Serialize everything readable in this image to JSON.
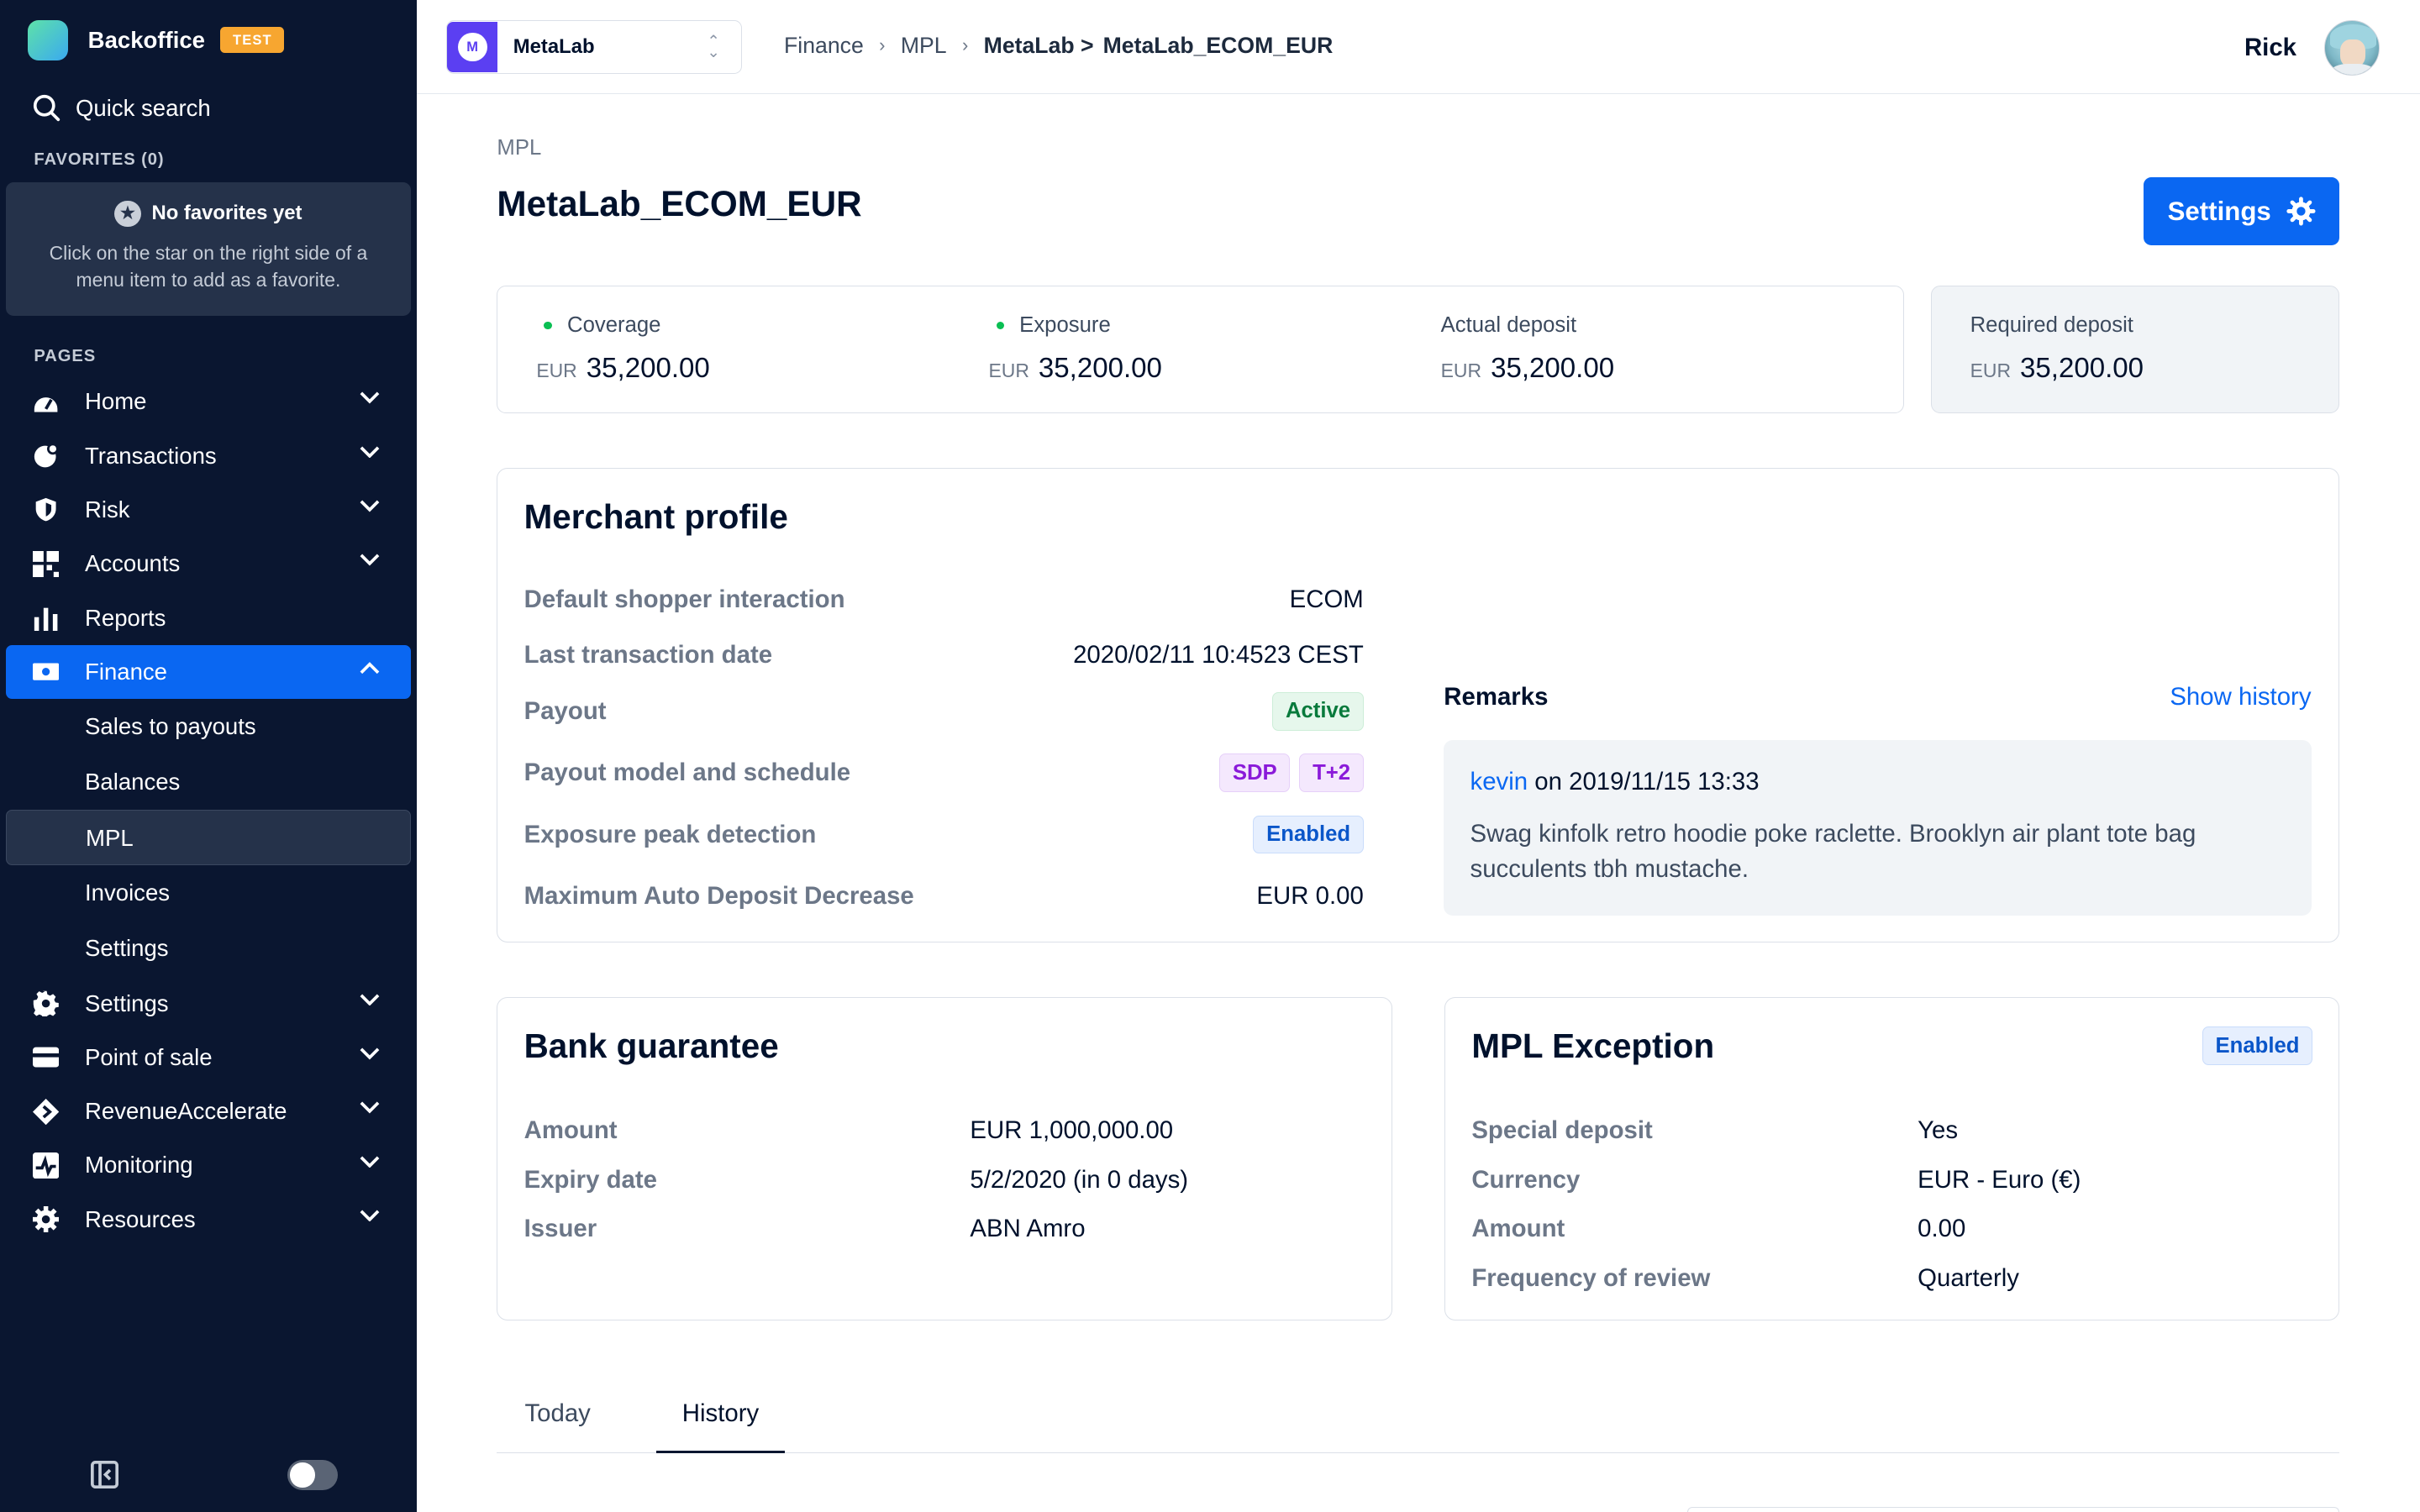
{
  "brand": {
    "name": "Backoffice",
    "env_badge": "TEST",
    "logo_colors": [
      "#5ee2a8",
      "#3aa9f0"
    ]
  },
  "search": {
    "label": "Quick search"
  },
  "favorites": {
    "title": "FAVORITES (0)",
    "empty_title": "No favorites yet",
    "empty_desc": "Click on the star on the right side of a menu item to add as a favorite."
  },
  "pages_title": "PAGES",
  "nav": {
    "home": "Home",
    "transactions": "Transactions",
    "risk": "Risk",
    "accounts": "Accounts",
    "reports": "Reports",
    "finance": "Finance",
    "finance_sub": {
      "sales_to_payouts": "Sales to payouts",
      "balances": "Balances",
      "mpl": "MPL",
      "invoices": "Invoices",
      "settings": "Settings"
    },
    "settings": "Settings",
    "point_of_sale": "Point of sale",
    "revenue_accelerate": "RevenueAccelerate",
    "monitoring": "Monitoring",
    "resources": "Resources"
  },
  "topbar": {
    "account": {
      "name": "MetaLab",
      "logo_letter": "M",
      "logo_color": "#5b3ff2"
    },
    "breadcrumb": {
      "c1": "Finance",
      "c2": "MPL",
      "c3": "MetaLab >",
      "c4": "MetaLab_ECOM_EUR"
    },
    "user_name": "Rick"
  },
  "page": {
    "subtitle": "MPL",
    "title": "MetaLab_ECOM_EUR",
    "settings_button": "Settings"
  },
  "stats": {
    "coverage": {
      "label": "Coverage",
      "currency": "EUR",
      "value": "35,200.00"
    },
    "exposure": {
      "label": "Exposure",
      "currency": "EUR",
      "value": "35,200.00"
    },
    "actual_deposit": {
      "label": "Actual deposit",
      "currency": "EUR",
      "value": "35,200.00"
    },
    "required_deposit": {
      "label": "Required deposit",
      "currency": "EUR",
      "value": "35,200.00"
    }
  },
  "merchant_profile": {
    "title": "Merchant profile",
    "default_shopper_interaction": {
      "label": "Default shopper interaction",
      "value": "ECOM"
    },
    "last_transaction_date": {
      "label": "Last transaction date",
      "value": "2020/02/11 10:4523 CEST"
    },
    "payout": {
      "label": "Payout",
      "value": "Active"
    },
    "payout_model": {
      "label": "Payout model and schedule",
      "tag1": "SDP",
      "tag2": "T+2"
    },
    "exposure_peak": {
      "label": "Exposure peak detection",
      "value": "Enabled"
    },
    "max_auto_deposit": {
      "label": "Maximum Auto Deposit Decrease",
      "value": "EUR 0.00"
    },
    "remarks": {
      "title": "Remarks",
      "show_history": "Show history",
      "author": "kevin",
      "meta": "on 2019/11/15 13:33",
      "text": "Swag kinfolk retro hoodie poke raclette. Brooklyn air plant tote bag succulents tbh mustache."
    }
  },
  "bank_guarantee": {
    "title": "Bank guarantee",
    "amount": {
      "label": "Amount",
      "value": "EUR 1,000,000.00"
    },
    "expiry": {
      "label": "Expiry date",
      "value": "5/2/2020 (in 0 days)"
    },
    "issuer": {
      "label": "Issuer",
      "value": "ABN Amro"
    }
  },
  "mpl_exception": {
    "title": "MPL Exception",
    "status": "Enabled",
    "special_deposit": {
      "label": "Special deposit",
      "value": "Yes"
    },
    "currency": {
      "label": "Currency",
      "value": "EUR - Euro (€)"
    },
    "amount": {
      "label": "Amount",
      "value": "0.00"
    },
    "frequency": {
      "label": "Frequency of review",
      "value": "Quarterly"
    }
  },
  "tabs": {
    "today": "Today",
    "history": "History",
    "active": "history"
  },
  "colors": {
    "sidebar_bg": "#0a1630",
    "accent": "#0a67f2",
    "positive": "#0abf53"
  }
}
